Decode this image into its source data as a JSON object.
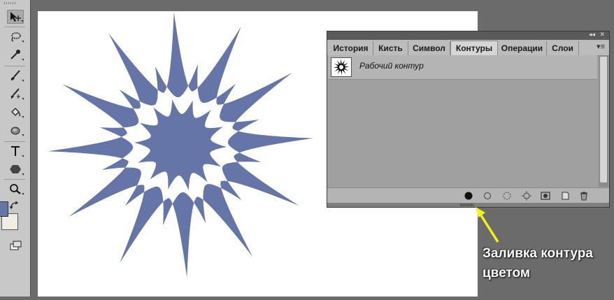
{
  "panel": {
    "tabs": [
      {
        "label": "История",
        "active": false
      },
      {
        "label": "Кисть",
        "active": false
      },
      {
        "label": "Символ",
        "active": false
      },
      {
        "label": "Контуры",
        "active": true
      },
      {
        "label": "Операции",
        "active": false
      },
      {
        "label": "Слои",
        "active": false
      }
    ],
    "path_item": {
      "label": "Рабочий контур"
    }
  },
  "tools": [
    "move-tool",
    "lasso-tool",
    "eyedropper-tool",
    "brush-tool",
    "history-brush-tool",
    "paint-bucket-tool",
    "blur-tool",
    "type-tool",
    "shape-tool",
    "zoom-tool"
  ],
  "colors": {
    "foreground": "#6675a8",
    "background": "#f0ede4",
    "shape_fill": "#6675a8",
    "annotation_arrow": "#f2f21a"
  },
  "annotation": {
    "line1": "Заливка контура",
    "line2": "цветом"
  }
}
